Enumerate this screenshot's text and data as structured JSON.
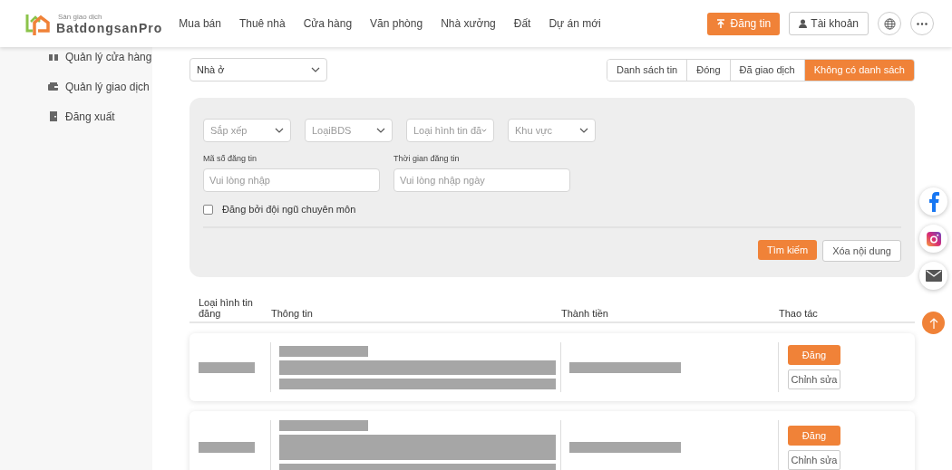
{
  "header": {
    "logo": {
      "tagline": "Sàn giao dịch",
      "name": "BatdongsanPro"
    },
    "nav": [
      "Mua bán",
      "Thuê nhà",
      "Cửa hàng",
      "Văn phòng",
      "Nhà xưởng",
      "Đất",
      "Dự án mới"
    ],
    "post_button": "Đăng tin",
    "account_button": "Tài khoản"
  },
  "sidebar": {
    "items": [
      {
        "label": "Quản lý cửa hàng"
      },
      {
        "label": "Quản lý giao dịch"
      },
      {
        "label": "Đăng xuất"
      }
    ]
  },
  "category_select": {
    "value": "Nhà ở"
  },
  "status_tabs": [
    {
      "label": "Danh sách tin",
      "selected": false
    },
    {
      "label": "Đóng",
      "selected": false
    },
    {
      "label": "Đã giao dịch",
      "selected": false
    },
    {
      "label": "Không có danh sách",
      "selected": true
    }
  ],
  "filters": {
    "selects": [
      {
        "placeholder": "Sắp xếp"
      },
      {
        "placeholder": "LoạiBDS"
      },
      {
        "placeholder": "Loại hình tin đă"
      },
      {
        "placeholder": "Khu vực"
      }
    ],
    "fields": [
      {
        "label": "Mã số đăng tin",
        "placeholder": "Vui lòng nhập"
      },
      {
        "label": "Thời gian đăng tin",
        "placeholder": "Vui lòng nhập ngày"
      }
    ],
    "checkbox": {
      "label": "Đăng bởi đội ngũ chuyên môn",
      "checked": false
    },
    "search_button": "Tìm kiếm",
    "clear_button": "Xóa nội dung"
  },
  "table": {
    "columns": [
      "Loại hình tin đăng",
      "Thông tin",
      "Thành tiền",
      "Thao tác"
    ],
    "rows": [
      {
        "post_button": "Đăng",
        "edit_button": "Chỉnh sửa"
      },
      {
        "post_button": "Đăng",
        "edit_button": "Chỉnh sửa"
      }
    ]
  }
}
